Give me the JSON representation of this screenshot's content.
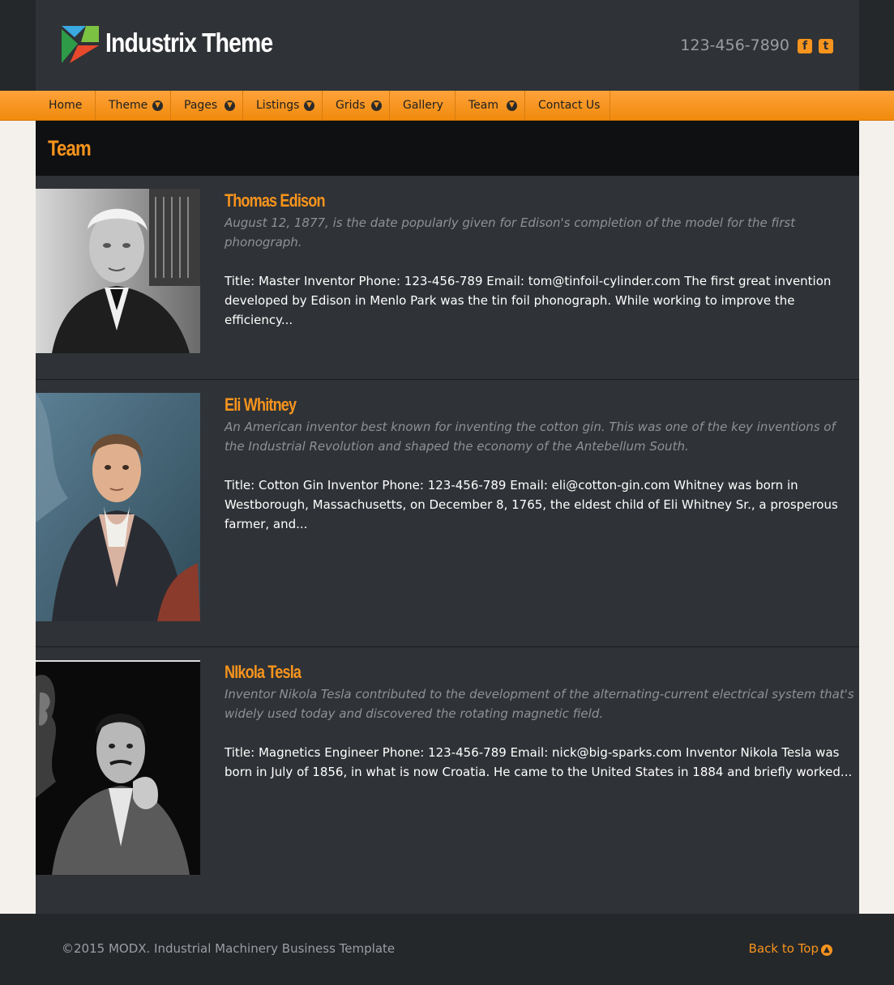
{
  "header": {
    "logo_text": "Industrix Theme",
    "phone": "123-456-7890",
    "social": [
      {
        "icon": "facebook-icon",
        "glyph": "f"
      },
      {
        "icon": "twitter-icon",
        "glyph": "t"
      }
    ]
  },
  "nav": {
    "items": [
      {
        "label": "Home",
        "has_dropdown": false
      },
      {
        "label": "Theme",
        "has_dropdown": true
      },
      {
        "label": "Pages",
        "has_dropdown": true
      },
      {
        "label": "Listings",
        "has_dropdown": true
      },
      {
        "label": "Grids",
        "has_dropdown": true
      },
      {
        "label": "Gallery",
        "has_dropdown": false
      },
      {
        "label": "Team",
        "has_dropdown": true
      },
      {
        "label": "Contact Us",
        "has_dropdown": false
      }
    ],
    "dropdown_glyph": "▼"
  },
  "page": {
    "title": "Team"
  },
  "members": [
    {
      "name": "Thomas Edison",
      "summary": "August 12, 1877, is the date popularly given for Edison's completion of the model for the first phonograph.",
      "body": "Title: Master Inventor Phone: 123-456-789 Email: tom@tinfoil-cylinder.com  The first great invention developed by Edison in Menlo Park was the tin foil phonograph. While working to improve the efficiency..."
    },
    {
      "name": "Eli Whitney",
      "summary": "An American inventor best known for inventing the cotton gin. This was one of the key inventions of the Industrial Revolution and shaped the economy of the Antebellum South.",
      "body": "Title: Cotton Gin Inventor Phone: 123-456-789 Email: eli@cotton-gin.com  Whitney was born in Westborough, Massachusetts, on December 8, 1765, the eldest child of Eli Whitney Sr., a prosperous farmer, and..."
    },
    {
      "name": "NIkola Tesla",
      "summary": "Inventor Nikola Tesla contributed to the development of the alternating-current electrical system that's widely used today and discovered the rotating magnetic field.",
      "body": "Title: Magnetics Engineer Phone: 123-456-789 Email: nick@big-sparks.com  Inventor Nikola Tesla was born in July of 1856, in what is now Croatia. He came to the United States in 1884 and briefly worked..."
    }
  ],
  "footer": {
    "copyright": "©2015 MODX. Industrial Machinery Business Template",
    "back_to_top": "Back to Top",
    "back_to_top_glyph": "▲"
  },
  "colors": {
    "accent": "#f7941d",
    "header_bg": "#2f3236",
    "content_bg": "#2f3236",
    "page_bg": "#f4f1ec"
  }
}
